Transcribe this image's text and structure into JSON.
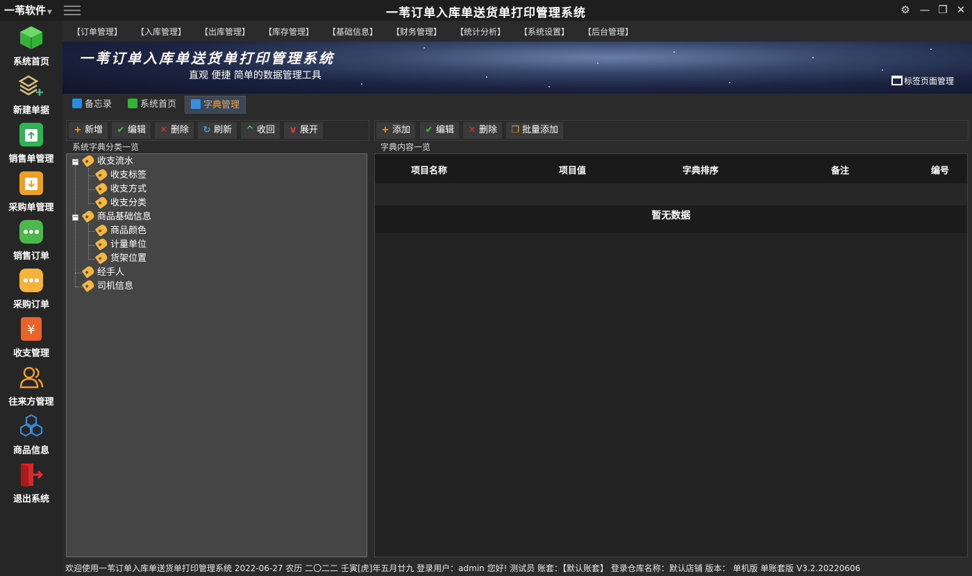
{
  "titlebar": {
    "brand": "一苇软件",
    "title": "一苇订单入库单送货单打印管理系统"
  },
  "leftnav": [
    {
      "label": "系统首页",
      "icon": "green-box-icon",
      "color": "#3cb43c"
    },
    {
      "label": "新建单据",
      "icon": "layers-add-icon",
      "color": "#c9b26a"
    },
    {
      "label": "销售单管理",
      "icon": "store-up-icon",
      "color": "#2fb455"
    },
    {
      "label": "采购单管理",
      "icon": "store-down-icon",
      "color": "#f0a020"
    },
    {
      "label": "销售订单",
      "icon": "chat-dots-icon",
      "color": "#4cb84c"
    },
    {
      "label": "采购订单",
      "icon": "chat-dots-icon",
      "color": "#f4b43c"
    },
    {
      "label": "收支管理",
      "icon": "yen-doc-icon",
      "color": "#e8642a"
    },
    {
      "label": "往来方管理",
      "icon": "users-icon",
      "color": "#f0a030"
    },
    {
      "label": "商品信息",
      "icon": "cubes-icon",
      "color": "#3c8ce0"
    },
    {
      "label": "退出系统",
      "icon": "exit-icon",
      "color": "#e03030"
    }
  ],
  "menu": [
    "【订单管理】",
    "【入库管理】",
    "【出库管理】",
    "【库存管理】",
    "【基础信息】",
    "【财务管理】",
    "【统计分析】",
    "【系统设置】",
    "【后台管理】"
  ],
  "banner": {
    "title": "一苇订单入库单送货单打印管理系统",
    "subtitle": "直观 便捷 简单的数据管理工具",
    "tab_manage": "标签页面管理"
  },
  "tabs": [
    {
      "label": "备忘录",
      "active": false
    },
    {
      "label": "系统首页",
      "active": false
    },
    {
      "label": "字典管理",
      "active": true
    }
  ],
  "left_toolbar": [
    "新增",
    "编辑",
    "删除",
    "刷新",
    "收回",
    "展开"
  ],
  "right_toolbar": [
    "添加",
    "编辑",
    "删除",
    "批量添加"
  ],
  "left_pane": {
    "title": "系统字典分类一览",
    "tree": [
      {
        "label": "收支流水",
        "children": [
          "收支标签",
          "收支方式",
          "收支分类"
        ]
      },
      {
        "label": "商品基础信息",
        "children": [
          "商品颜色",
          "计量单位",
          "货架位置"
        ]
      },
      {
        "label": "经手人",
        "children": []
      },
      {
        "label": "司机信息",
        "children": []
      }
    ]
  },
  "right_pane": {
    "title": "字典内容一览",
    "columns": [
      "项目名称",
      "项目值",
      "字典排序",
      "备注",
      "编号"
    ],
    "empty_text": "暂无数据"
  },
  "statusbar": "欢迎使用一苇订单入库单送货单打印管理系统 2022-06-27 农历 二〇二二 壬寅[虎]年五月廿九 登录用户：admin 您好! 测试员 账套：【默认账套】 登录仓库名称：默认店铺 版本： 单机版 单账套版 V3.2.20220606"
}
